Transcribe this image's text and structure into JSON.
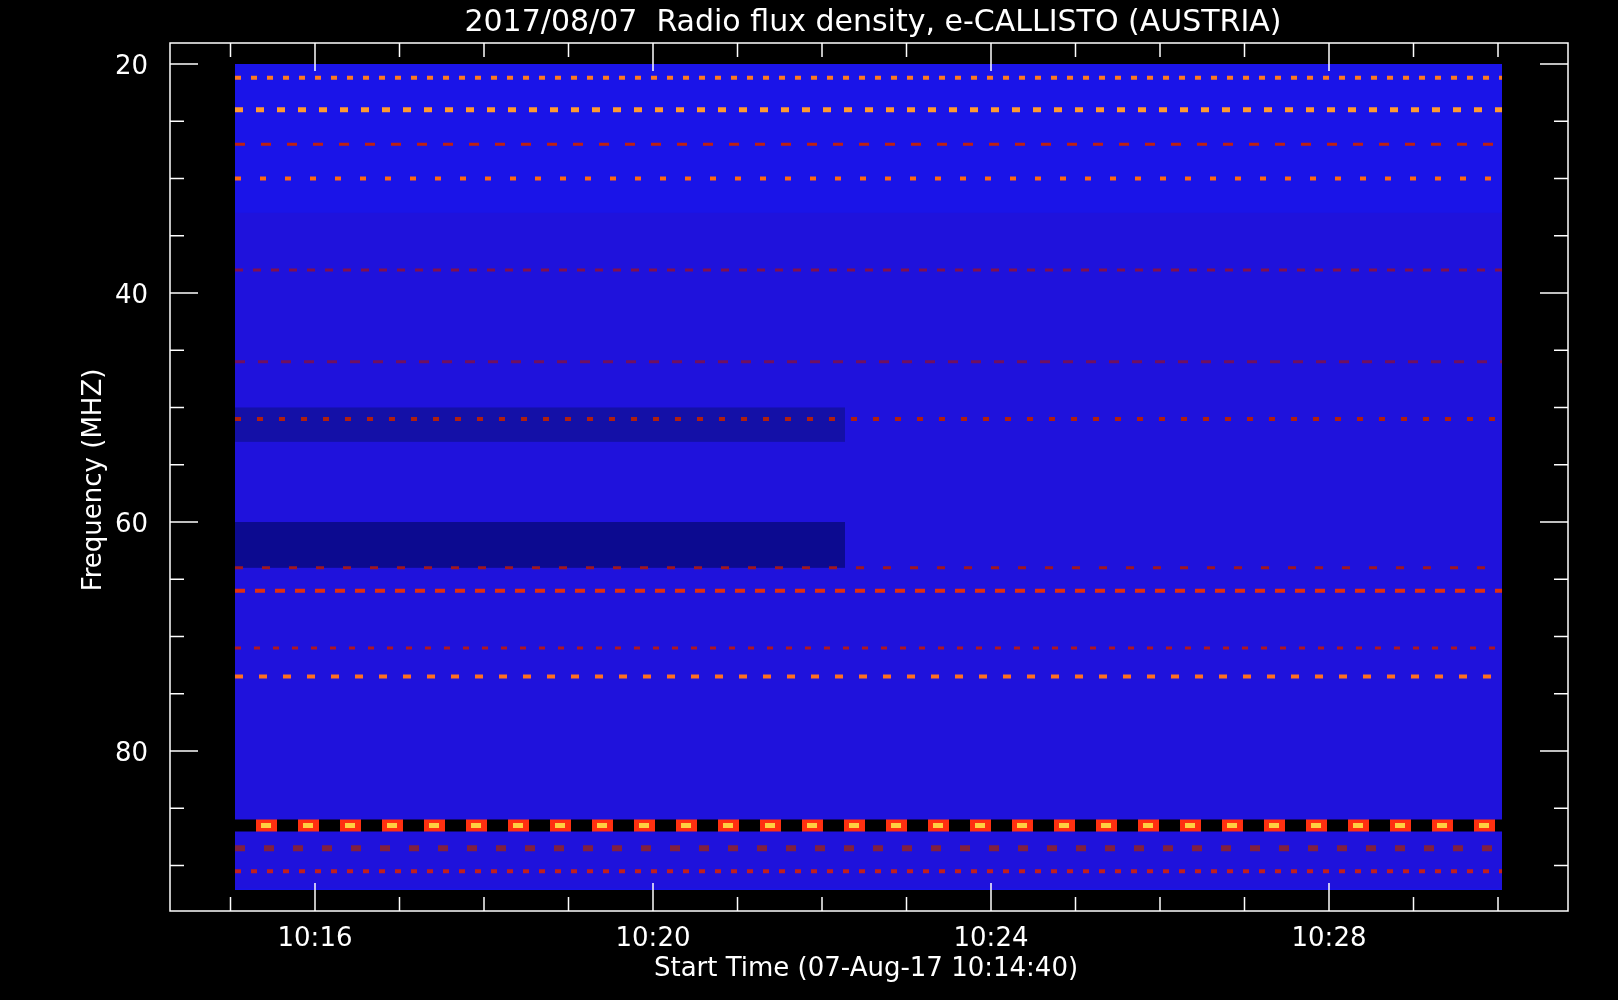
{
  "title": "2017/08/07  Radio flux density, e-CALLISTO (AUSTRIA)",
  "y_axis": {
    "label": "Frequency (MHZ)",
    "ticks": [
      "20",
      "40",
      "60",
      "80"
    ]
  },
  "x_axis": {
    "label": "Start Time (07-Aug-17 10:14:40)",
    "ticks": [
      "10:16",
      "10:20",
      "10:24",
      "10:28"
    ]
  }
}
